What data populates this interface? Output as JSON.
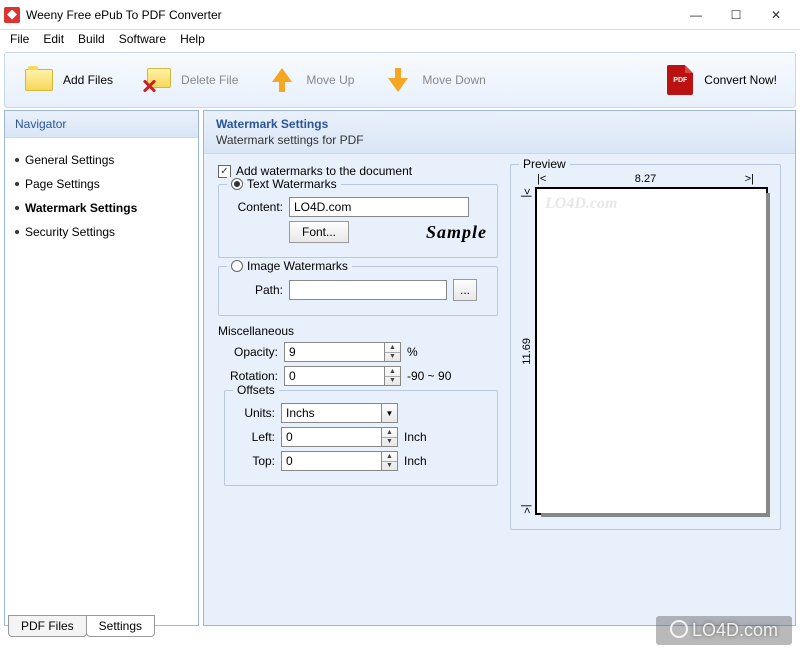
{
  "window": {
    "title": "Weeny Free ePub To PDF Converter"
  },
  "menu": {
    "file": "File",
    "edit": "Edit",
    "build": "Build",
    "software": "Software",
    "help": "Help"
  },
  "toolbar": {
    "add_files": "Add Files",
    "delete_file": "Delete File",
    "move_up": "Move Up",
    "move_down": "Move Down",
    "convert": "Convert Now!"
  },
  "navigator": {
    "title": "Navigator",
    "items": [
      "General Settings",
      "Page Settings",
      "Watermark Settings",
      "Security Settings"
    ],
    "active_index": 2
  },
  "panel": {
    "title": "Watermark Settings",
    "subtitle": "Watermark settings for PDF",
    "add_wm_label": "Add watermarks to the document",
    "add_wm_checked": true,
    "text_wm_label": "Text Watermarks",
    "text_wm_selected": true,
    "content_label": "Content:",
    "content_value": "LO4D.com",
    "font_btn": "Font...",
    "sample_label": "Sample",
    "image_wm_label": "Image Watermarks",
    "image_wm_selected": false,
    "path_label": "Path:",
    "path_value": "",
    "browse_btn": "...",
    "misc_label": "Miscellaneous",
    "opacity_label": "Opacity:",
    "opacity_value": "9",
    "opacity_suffix": "%",
    "rotation_label": "Rotation:",
    "rotation_value": "0",
    "rotation_suffix": "-90 ~ 90",
    "offsets_label": "Offsets",
    "units_label": "Units:",
    "units_value": "Inchs",
    "left_label": "Left:",
    "left_value": "0",
    "top_label": "Top:",
    "top_value": "0",
    "inch_suffix": "Inch",
    "preview_label": "Preview",
    "preview_width": "8.27",
    "preview_height": "11.69",
    "preview_wm_text": "LO4D.com"
  },
  "tabs": {
    "pdf_files": "PDF Files",
    "settings": "Settings",
    "active": "settings"
  },
  "site_watermark": "LO4D.com"
}
